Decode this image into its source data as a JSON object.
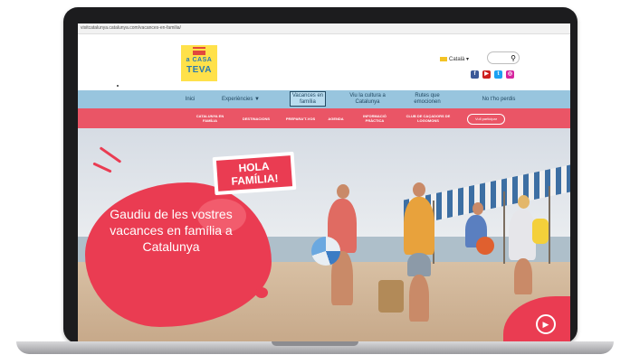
{
  "browser": {
    "url": "visitcatalunya.catalunya.com/vacances-en-familia/"
  },
  "header": {
    "logo": {
      "line1": "a CASA",
      "line2": "TEVA"
    },
    "language": "Català ▾",
    "search_icon": "search-icon",
    "socials": [
      {
        "name": "facebook-icon",
        "glyph": "f",
        "color": "#3b5998"
      },
      {
        "name": "youtube-icon",
        "glyph": "▶",
        "color": "#cd201f"
      },
      {
        "name": "twitter-icon",
        "glyph": "t",
        "color": "#1da1f2"
      },
      {
        "name": "instagram-icon",
        "glyph": "◎",
        "color": "#d6249f"
      }
    ]
  },
  "nav": {
    "items": [
      {
        "label": "Inici"
      },
      {
        "label": "Experiències ▼"
      },
      {
        "label": "Vacances en família"
      },
      {
        "label": "Viu la cultura a Catalunya"
      },
      {
        "label": "Rutes que emocionen"
      },
      {
        "label": "No t'ho perdis"
      }
    ]
  },
  "subnav": {
    "items": [
      {
        "label": "CATALUNYA EN FAMÍLIA"
      },
      {
        "label": "DESTINACIONS"
      },
      {
        "label": "PREPARA'T-VOS"
      },
      {
        "label": "AGENDA"
      },
      {
        "label": "INFORMACIÓ PRÀCTICA"
      },
      {
        "label": "CLUB DE CAÇADORS DE LOGOMONS"
      }
    ],
    "button": "Vull participar"
  },
  "hero": {
    "badge_line1": "HOLA",
    "badge_line2": "FAMÍLIA!",
    "headline": "Gaudiu de les vostres vacances en família a Catalunya",
    "play_icon": "play-icon"
  },
  "colors": {
    "primary": "#ea3c52",
    "nav": "#98c5de",
    "logo": "#ffe14a"
  }
}
